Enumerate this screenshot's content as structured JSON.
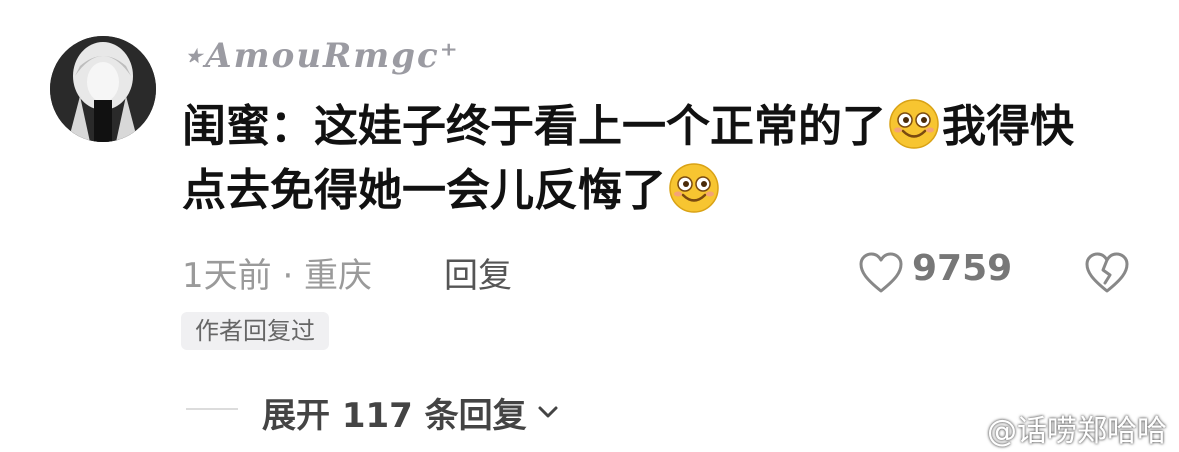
{
  "comment": {
    "username": "⋆AmouRmgc⁺",
    "text_line1": "闺蜜：这娃子终于看上一个正常的了",
    "text_line1b": "我得快",
    "text_line2": "点去免得她一会儿反悔了",
    "emoji_name": "smile-emoji",
    "time_location": "1天前 · 重庆",
    "reply_label": "回复",
    "like_count": "9759",
    "author_replied_badge": "作者回复过",
    "expand_label": "展开 117 条回复"
  },
  "watermark": {
    "text": "@话唠郑哈哈"
  },
  "colors": {
    "text_primary": "#111111",
    "text_secondary": "#9a9a9a",
    "badge_bg": "#f0f0f2"
  }
}
